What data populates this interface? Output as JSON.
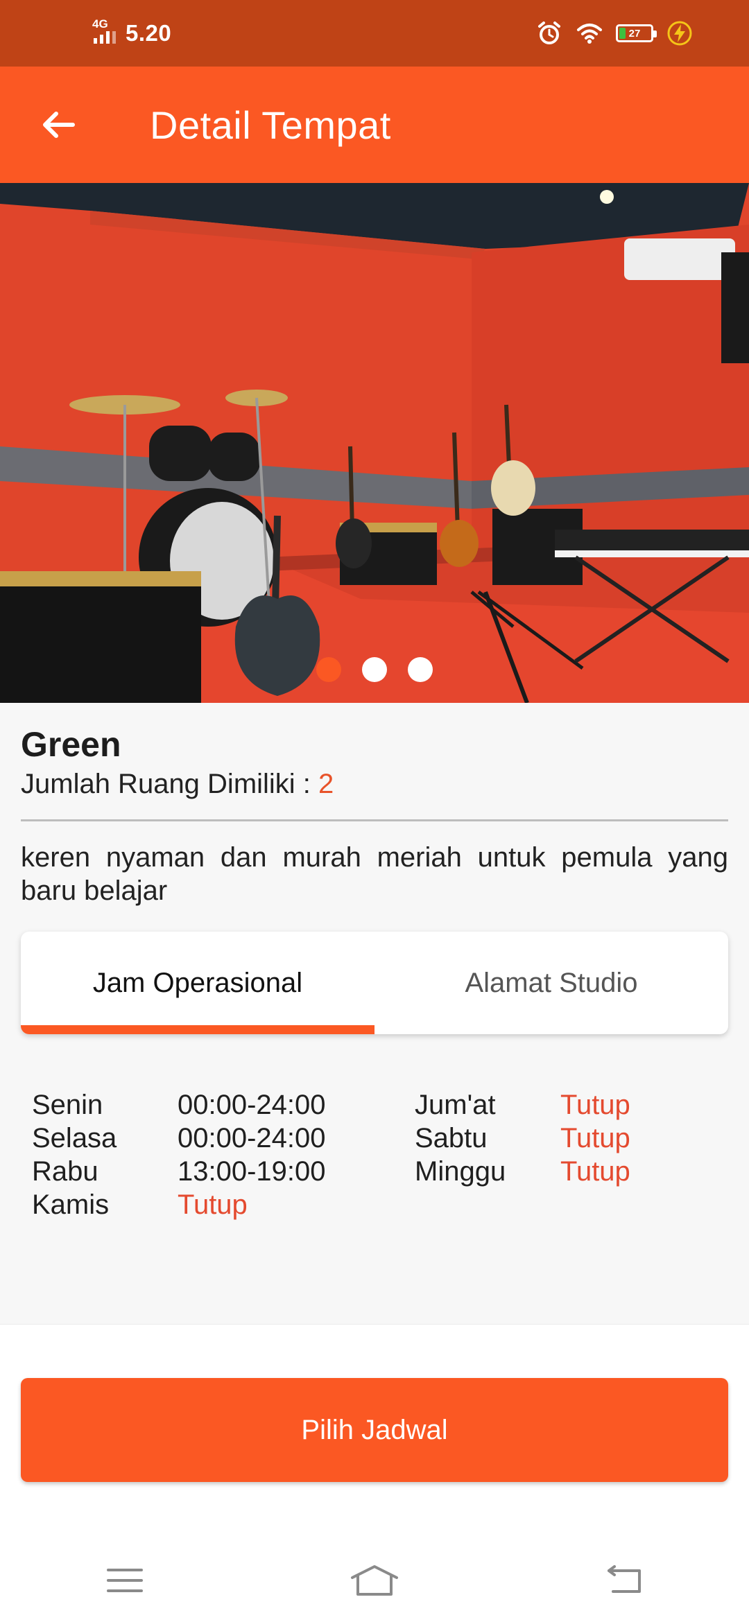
{
  "status_bar": {
    "network": "4G",
    "time": "5.20",
    "battery_level": "27",
    "battery_fraction": 0.27,
    "battery_color": "#3fbf3f",
    "icons": [
      "signal-icon",
      "alarm-icon",
      "wifi-icon",
      "battery-icon",
      "charging-icon"
    ]
  },
  "app_bar": {
    "title": "Detail Tempat",
    "back_icon": "arrow-left-icon"
  },
  "carousel": {
    "image": "music-studio-photo",
    "page_count": 3,
    "active_index": 0
  },
  "studio": {
    "name": "Green",
    "room_label": "Jumlah Ruang Dimiliki : ",
    "room_count": "2",
    "description": "keren nyaman dan murah meriah untuk pemula yang baru belajar"
  },
  "tabs": [
    {
      "label": "Jam Operasional",
      "active": true
    },
    {
      "label": "Alamat Studio",
      "active": false
    }
  ],
  "hours": {
    "left": [
      {
        "day": "Senin",
        "time": "00:00-24:00",
        "closed": false
      },
      {
        "day": "Selasa",
        "time": "00:00-24:00",
        "closed": false
      },
      {
        "day": "Rabu",
        "time": "13:00-19:00",
        "closed": false
      },
      {
        "day": "Kamis",
        "time": "Tutup",
        "closed": true
      }
    ],
    "right": [
      {
        "day": "Jum'at",
        "time": "Tutup",
        "closed": true
      },
      {
        "day": "Sabtu",
        "time": "Tutup",
        "closed": true
      },
      {
        "day": "Minggu",
        "time": "Tutup",
        "closed": true
      }
    ]
  },
  "action": {
    "label": "Pilih Jadwal"
  },
  "nav": {
    "icons": [
      "menu-icon",
      "home-icon",
      "back-icon"
    ]
  },
  "colors": {
    "status_bar": "#bf4316",
    "app_bar": "#fb5823",
    "accent": "#fb5823",
    "closed_text": "#e44a2f",
    "count_text": "#e8532a"
  }
}
